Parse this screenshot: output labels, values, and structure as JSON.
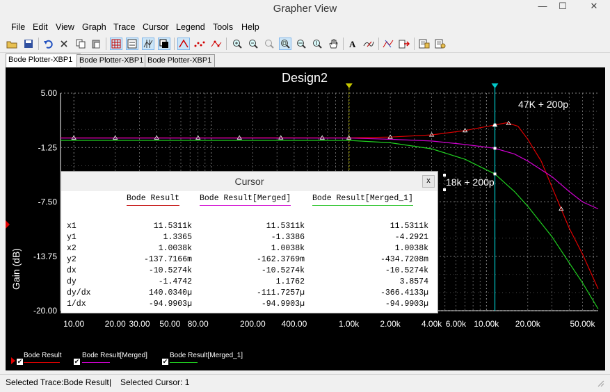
{
  "window": {
    "title": "Grapher View",
    "min": "—",
    "max": "☐",
    "close": "✕"
  },
  "menu": [
    "File",
    "Edit",
    "View",
    "Graph",
    "Trace",
    "Cursor",
    "Legend",
    "Tools",
    "Help"
  ],
  "tabs": [
    "Bode Plotter-XBP1",
    "Bode Plotter-XBP1",
    "Bode Plotter-XBP1"
  ],
  "status": {
    "trace": "Selected Trace:Bode Result",
    "sep": "|",
    "cursor": "Selected Cursor: 1"
  },
  "chart_data": {
    "type": "line",
    "title": "Design2",
    "ylabel": "Gain (dB)",
    "xlabel": "",
    "x_scale": "log",
    "x_ticks": [
      "10.00",
      "20.00",
      "30.00",
      "50.00",
      "80.00",
      "200.00",
      "400.00",
      "1.00k",
      "2.00k",
      "4.00k",
      "6.00k",
      "10.00k",
      "20.00k",
      "50.00k"
    ],
    "y_ticks": [
      "5.00",
      "-1.25",
      "-7.50",
      "-13.75",
      "-20.00"
    ],
    "ylim": [
      -20,
      5
    ],
    "xlim": [
      8,
      65000
    ],
    "grid": true,
    "colors": {
      "bode_result": "#e00000",
      "merged": "#d000d0",
      "merged_1": "#20d020",
      "cursor1": "#c8c800",
      "cursor2": "#00c8c8"
    },
    "annotations": [
      "47K + 200p",
      "18k + 200p"
    ],
    "cursors_x": [
      1003.8,
      11531.1
    ],
    "series": [
      {
        "name": "Bode Result",
        "color": "#e00000",
        "x": [
          8,
          20,
          50,
          100,
          300,
          1000,
          2000,
          4000,
          7000,
          11531,
          14000,
          17000,
          20000,
          25000,
          30000,
          40000,
          50000,
          65000
        ],
        "y": [
          -0.14,
          -0.14,
          -0.14,
          -0.14,
          -0.13,
          -0.14,
          -0.05,
          0.2,
          0.7,
          1.34,
          1.6,
          1.2,
          -0.3,
          -2.8,
          -5.8,
          -10.5,
          -13.5,
          -17.5
        ]
      },
      {
        "name": "Bode Result[Merged]",
        "color": "#d000d0",
        "x": [
          8,
          100,
          500,
          1000,
          2000,
          4000,
          7000,
          11531,
          16000,
          20000,
          30000,
          40000,
          50000,
          65000
        ],
        "y": [
          -0.16,
          -0.16,
          -0.16,
          -0.16,
          -0.3,
          -0.5,
          -0.9,
          -1.34,
          -2.0,
          -2.8,
          -4.6,
          -6.3,
          -7.5,
          -8.3
        ]
      },
      {
        "name": "Bode Result[Merged_1]",
        "color": "#20d020",
        "x": [
          8,
          100,
          500,
          1000,
          2000,
          4000,
          7000,
          11531,
          16000,
          20000,
          30000,
          40000,
          50000,
          65000
        ],
        "y": [
          -0.43,
          -0.43,
          -0.43,
          -0.43,
          -0.7,
          -1.4,
          -2.6,
          -4.29,
          -6.3,
          -8.0,
          -11.5,
          -14.5,
          -16.8,
          -19.8
        ]
      }
    ]
  },
  "cursor_panel": {
    "title": "Cursor",
    "close": "x",
    "columns": [
      {
        "name": "Bode Result",
        "color": "#c00000"
      },
      {
        "name": "Bode Result[Merged]",
        "color": "#d000d0"
      },
      {
        "name": "Bode Result[Merged_1]",
        "color": "#20c020"
      }
    ],
    "rows": [
      {
        "label": "x1",
        "values": [
          "11.5311k",
          "11.5311k",
          "11.5311k"
        ]
      },
      {
        "label": "y1",
        "values": [
          "1.3365",
          "-1.3386",
          "-4.2921"
        ]
      },
      {
        "label": "x2",
        "values": [
          "1.0038k",
          "1.0038k",
          "1.0038k"
        ]
      },
      {
        "label": "y2",
        "values": [
          "-137.7166m",
          "-162.3769m",
          "-434.7208m"
        ]
      },
      {
        "label": "dx",
        "values": [
          "-10.5274k",
          "-10.5274k",
          "-10.5274k"
        ]
      },
      {
        "label": "dy",
        "values": [
          "-1.4742",
          "1.1762",
          "3.8574"
        ]
      },
      {
        "label": "dy/dx",
        "values": [
          "140.0340µ",
          "-111.7257µ",
          "-366.4133µ"
        ]
      },
      {
        "label": "1/dx",
        "values": [
          "-94.9903µ",
          "-94.9903µ",
          "-94.9903µ"
        ]
      }
    ]
  },
  "legend": [
    "Bode Result",
    "Bode Result[Merged]",
    "Bode Result[Merged_1]"
  ]
}
